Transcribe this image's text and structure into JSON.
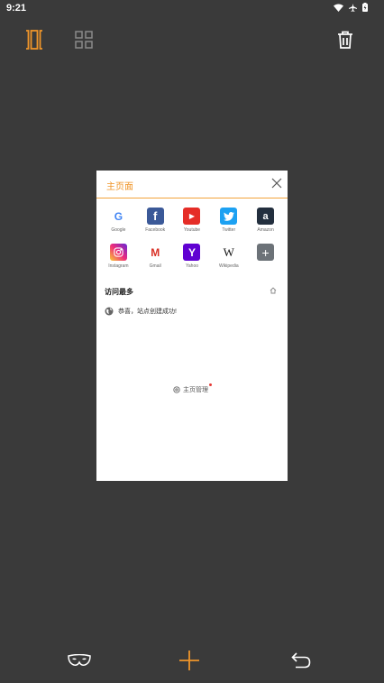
{
  "status": {
    "time": "9:21"
  },
  "colors": {
    "accent": "#f0962a",
    "background": "#3a3a3a",
    "card": "#ffffff"
  },
  "toolbar": {
    "icons": [
      "carousel-view-icon",
      "grid-view-icon",
      "trash-icon"
    ]
  },
  "tab": {
    "title": "主页面",
    "shortcuts": [
      {
        "label": "Google",
        "icon": "google-icon",
        "glyph": "G"
      },
      {
        "label": "Facebook",
        "icon": "facebook-icon",
        "glyph": "f"
      },
      {
        "label": "Youtube",
        "icon": "youtube-icon",
        "glyph": "▶"
      },
      {
        "label": "Twitter",
        "icon": "twitter-icon",
        "glyph": ""
      },
      {
        "label": "Amazon",
        "icon": "amazon-icon",
        "glyph": "a"
      },
      {
        "label": "Instagram",
        "icon": "instagram-icon",
        "glyph": ""
      },
      {
        "label": "Gmail",
        "icon": "gmail-icon",
        "glyph": "M"
      },
      {
        "label": "Yahoo",
        "icon": "yahoo-icon",
        "glyph": "Y"
      },
      {
        "label": "Wikipedia",
        "icon": "wikipedia-icon",
        "glyph": "W"
      },
      {
        "label": "",
        "icon": "add-shortcut-icon",
        "glyph": "+"
      }
    ],
    "most_visited_title": "访问最多",
    "most_visited_item": "恭喜，站点创建成功!",
    "home_manage": "主页管理"
  },
  "bottom": {
    "icons": [
      "incognito-mask-icon",
      "add-tab-icon",
      "back-icon"
    ]
  }
}
